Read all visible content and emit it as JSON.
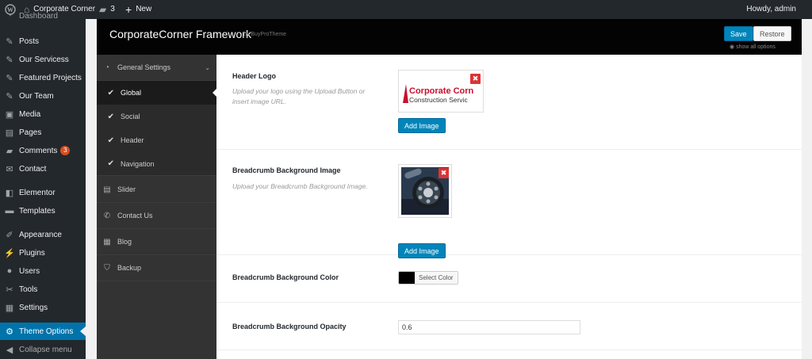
{
  "adminbar": {
    "site": "Corporate Corner",
    "comments": "3",
    "new": "New",
    "howdy": "Howdy, admin"
  },
  "menu": {
    "dashboard": "Dashboard",
    "posts": "Posts",
    "services": "Our Servicess",
    "featured": "Featured Projects",
    "team": "Our Team",
    "media": "Media",
    "pages": "Pages",
    "comments": "Comments",
    "comments_badge": "3",
    "contact": "Contact",
    "elementor": "Elementor",
    "templates": "Templates",
    "appearance": "Appearance",
    "plugins": "Plugins",
    "users": "Users",
    "tools": "Tools",
    "settings": "Settings",
    "theme_options": "Theme Options",
    "collapse": "Collapse menu"
  },
  "panel": {
    "title": "CorporateCorner Framework",
    "subtitle": "by BuyProTheme",
    "save": "Save",
    "restore": "Restore",
    "show_all": "show all options"
  },
  "subnav": {
    "general": "General Settings",
    "global": "Global",
    "social": "Social",
    "header": "Header",
    "navigation": "Navigation",
    "slider": "Slider",
    "contact": "Contact Us",
    "blog": "Blog",
    "backup": "Backup"
  },
  "fields": {
    "logo": {
      "label": "Header Logo",
      "desc": "Upload your logo using the Upload Button or insert image URL.",
      "logo_title": "Corporate Corn",
      "logo_sub": "Construction Servic",
      "button": "Add Image"
    },
    "bc_image": {
      "label": "Breadcrumb Background Image",
      "desc": "Upload your Breadcrumb Background Image.",
      "button": "Add Image"
    },
    "bc_color": {
      "label": "Breadcrumb Background Color",
      "button": "Select Color",
      "swatch": "#000000"
    },
    "bc_opacity": {
      "label": "Breadcrumb Background Opacity",
      "value": "0.6"
    }
  },
  "colors": {
    "accent": "#0073aa",
    "button": "#0085ba",
    "badge": "#d54e21",
    "delete": "#dd3333",
    "logo_red": "#c8102e"
  }
}
